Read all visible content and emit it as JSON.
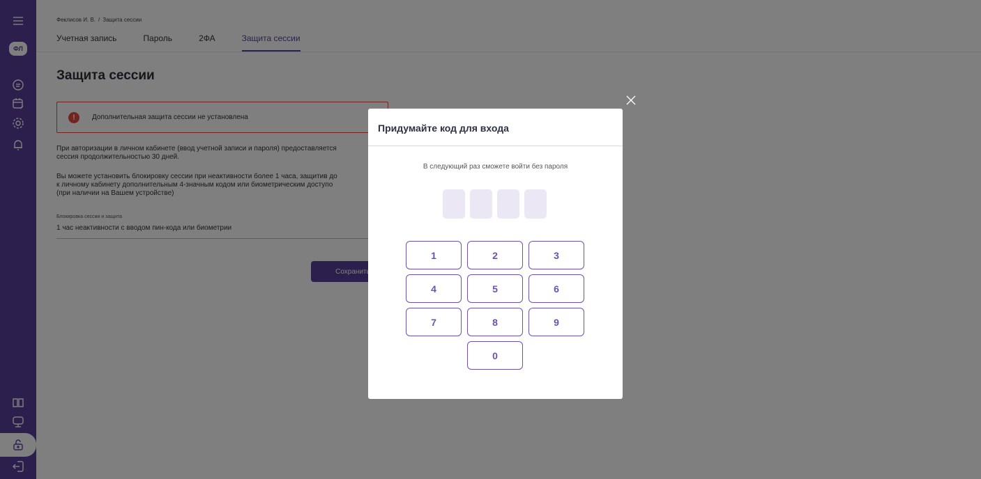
{
  "sidebar": {
    "avatar_initials": "ФЛ",
    "icons": [
      "menu-icon",
      "document-icon",
      "calendar-edit-icon",
      "gear-icon",
      "bell-icon",
      "book-icon",
      "presentation-icon",
      "lock-icon",
      "logout-icon"
    ]
  },
  "breadcrumb": {
    "user": "Феклисов И. В.",
    "separator": "/",
    "current": "Защита сессии"
  },
  "tabs": [
    {
      "label": "Учетная запись",
      "active": false
    },
    {
      "label": "Пароль",
      "active": false
    },
    {
      "label": "2ФА",
      "active": false
    },
    {
      "label": "Защита сессии",
      "active": true
    }
  ],
  "page": {
    "title": "Защита сессии",
    "alert_text": "Дополнительная защита сессии не установлена",
    "paragraph1": "При авторизации в личном кабинете (ввод учетной записи и пароля) предоставляется\nсессия продолжительностью 30 дней.",
    "paragraph2": "Вы можете установить блокировку сессии при неактивности более 1 часа, защитив до\nк личному кабинету дополнительным 4-значным кодом или биометрическим доступо\n(при наличии на Вашем устройстве)",
    "field_label": "Блокировка сессии и защита",
    "field_value": "1 час неактивности с вводом пин-кода или биометрии",
    "save_label": "Сохранить"
  },
  "modal": {
    "title": "Придумайте код для входа",
    "subtitle": "В следующий раз сможете войти без пароля",
    "keys": [
      "1",
      "2",
      "3",
      "4",
      "5",
      "6",
      "7",
      "8",
      "9",
      "0"
    ]
  },
  "colors": {
    "brand": "#5b3f9a",
    "key_border": "#6c51b0",
    "pin_box": "#ebe7f5",
    "alert": "#e5483e"
  }
}
